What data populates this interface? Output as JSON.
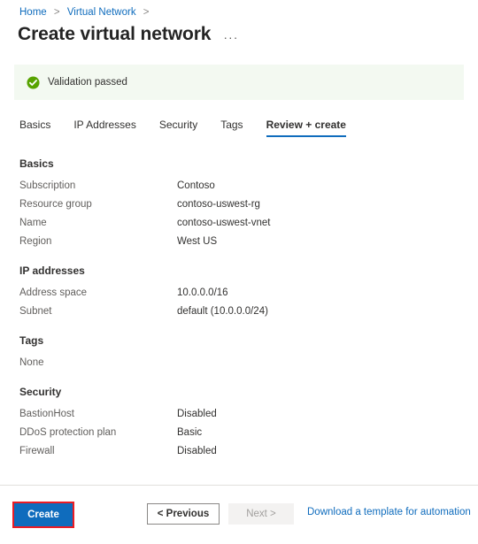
{
  "breadcrumb": {
    "items": [
      {
        "label": "Home"
      },
      {
        "label": "Virtual Network"
      }
    ],
    "separator": ">"
  },
  "header": {
    "title": "Create virtual network",
    "more_menu": "···"
  },
  "banner": {
    "icon": "check-circle-icon",
    "message": "Validation passed",
    "background": "#f3f9f1",
    "icon_color": "#57a300"
  },
  "tabs": [
    {
      "label": "Basics",
      "active": false
    },
    {
      "label": "IP Addresses",
      "active": false
    },
    {
      "label": "Security",
      "active": false
    },
    {
      "label": "Tags",
      "active": false
    },
    {
      "label": "Review + create",
      "active": true
    }
  ],
  "sections": {
    "basics": {
      "title": "Basics",
      "rows": [
        {
          "label": "Subscription",
          "value": "Contoso"
        },
        {
          "label": "Resource group",
          "value": "contoso-uswest-rg"
        },
        {
          "label": "Name",
          "value": "contoso-uswest-vnet"
        },
        {
          "label": "Region",
          "value": "West US"
        }
      ]
    },
    "ip_addresses": {
      "title": "IP addresses",
      "rows": [
        {
          "label": "Address space",
          "value": "10.0.0.0/16"
        },
        {
          "label": "Subnet",
          "value": "default (10.0.0.0/24)"
        }
      ]
    },
    "tags": {
      "title": "Tags",
      "value": "None"
    },
    "security": {
      "title": "Security",
      "rows": [
        {
          "label": "BastionHost",
          "value": "Disabled"
        },
        {
          "label": "DDoS protection plan",
          "value": "Basic"
        },
        {
          "label": "Firewall",
          "value": "Disabled"
        }
      ]
    }
  },
  "footer": {
    "create_label": "Create",
    "previous_label": "< Previous",
    "next_label": "Next >",
    "template_link": "Download a template for automation",
    "accent_color": "#0f6cbd",
    "highlight_color": "#ec1c24"
  }
}
